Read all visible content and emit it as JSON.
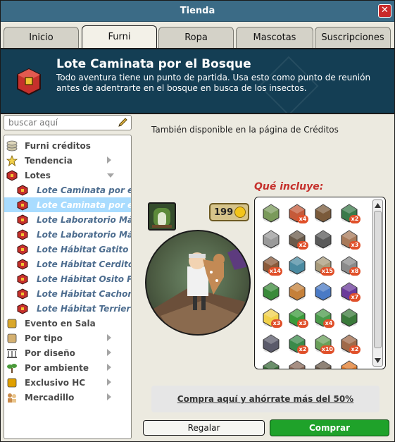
{
  "window": {
    "title": "Tienda"
  },
  "tabs": [
    {
      "label": "Inicio"
    },
    {
      "label": "Furni"
    },
    {
      "label": "Ropa"
    },
    {
      "label": "Mascotas"
    },
    {
      "label": "Suscripciones"
    }
  ],
  "active_tab": "Furni",
  "banner": {
    "title": "Lote Caminata por el Bosque",
    "description": "Todo aventura tiene un punto de partida. Usa esto como punto de reunión antes de adentrarte en el bosque en busca de los insectos."
  },
  "search": {
    "placeholder": "buscar aquí"
  },
  "categories": [
    {
      "label": "Furni créditos",
      "icon": "coins-stack-icon"
    },
    {
      "label": "Tendencia",
      "icon": "star-icon",
      "expandable": true
    },
    {
      "label": "Lotes",
      "icon": "bundle-cube-icon",
      "expanded": true
    },
    {
      "label": "Lote Caminata por el Bosque",
      "icon": "bundle-cube-icon",
      "sub": true
    },
    {
      "label": "Lote Caminata por el Bosque",
      "icon": "bundle-cube-icon",
      "sub": true,
      "selected": true
    },
    {
      "label": "Lote Laboratorio Mágico",
      "icon": "bundle-cube-icon",
      "sub": true
    },
    {
      "label": "Lote Laboratorio Mágico",
      "icon": "bundle-cube-icon",
      "sub": true
    },
    {
      "label": "Lote Hábitat Gatito",
      "icon": "bundle-cube-icon",
      "sub": true
    },
    {
      "label": "Lote Hábitat Cerdito",
      "icon": "bundle-cube-icon",
      "sub": true
    },
    {
      "label": "Lote Hábitat Osito Polar",
      "icon": "bundle-cube-icon",
      "sub": true
    },
    {
      "label": "Lote Hábitat Cachorro",
      "icon": "bundle-cube-icon",
      "sub": true
    },
    {
      "label": "Lote Hábitat Terrier",
      "icon": "bundle-cube-icon",
      "sub": true
    },
    {
      "label": "Evento en Sala",
      "icon": "event-box-icon"
    },
    {
      "label": "Por tipo",
      "icon": "box-icon",
      "expandable": true
    },
    {
      "label": "Por diseño",
      "icon": "columns-icon",
      "expandable": true
    },
    {
      "label": "Por ambiente",
      "icon": "plant-icon",
      "expandable": true
    },
    {
      "label": "Exclusivo HC",
      "icon": "hc-badge-icon",
      "expandable": true
    },
    {
      "label": "Mercadillo",
      "icon": "people-icon",
      "expandable": true
    }
  ],
  "content": {
    "availability_text": "También disponible en la página de Créditos",
    "price": "199",
    "includes_title": "Qué incluye:",
    "items": [
      {
        "icon": "shelf-icon",
        "qty": ""
      },
      {
        "icon": "red-plant-icon",
        "qty": "x4"
      },
      {
        "icon": "leaves-icon",
        "qty": ""
      },
      {
        "icon": "pine-tree-icon",
        "qty": "x2"
      },
      {
        "icon": "rock-icon",
        "qty": ""
      },
      {
        "icon": "stump-icon",
        "qty": "x2"
      },
      {
        "icon": "bench-icon",
        "qty": ""
      },
      {
        "icon": "rug-icon",
        "qty": "x3"
      },
      {
        "icon": "log-icon",
        "qty": "x14"
      },
      {
        "icon": "fountain-icon",
        "qty": ""
      },
      {
        "icon": "path-tile-icon",
        "qty": "x15"
      },
      {
        "icon": "stone-pillar-icon",
        "qty": "x8"
      },
      {
        "icon": "palm-icon",
        "qty": ""
      },
      {
        "icon": "deer-icon",
        "qty": ""
      },
      {
        "icon": "blue-flower-icon",
        "qty": ""
      },
      {
        "icon": "purple-bush-icon",
        "qty": "x7"
      },
      {
        "icon": "sunbeam-icon",
        "qty": "x3"
      },
      {
        "icon": "tall-grass-icon",
        "qty": "x3"
      },
      {
        "icon": "shrub-icon",
        "qty": "x4"
      },
      {
        "icon": "oak-tree-icon",
        "qty": ""
      },
      {
        "icon": "lantern-icon",
        "qty": ""
      },
      {
        "icon": "fern-icon",
        "qty": "x2"
      },
      {
        "icon": "grass-tile-icon",
        "qty": "x10"
      },
      {
        "icon": "post-icon",
        "qty": "x2"
      },
      {
        "icon": "small-tree-icon",
        "qty": ""
      },
      {
        "icon": "vine-icon",
        "qty": ""
      },
      {
        "icon": "branch-icon",
        "qty": ""
      },
      {
        "icon": "fire-icon",
        "qty": ""
      }
    ],
    "promo_text": "Compra aquí y ahórrate más del 50%",
    "gift_button": "Regalar",
    "buy_button": "Comprar"
  },
  "colors": {
    "titlebar": "#3b6b86",
    "banner": "#143e54",
    "selected_category": "#a9dcff",
    "buy_button": "#1fa22a",
    "includes_title": "#c5302c",
    "badge": "#e0502a"
  }
}
